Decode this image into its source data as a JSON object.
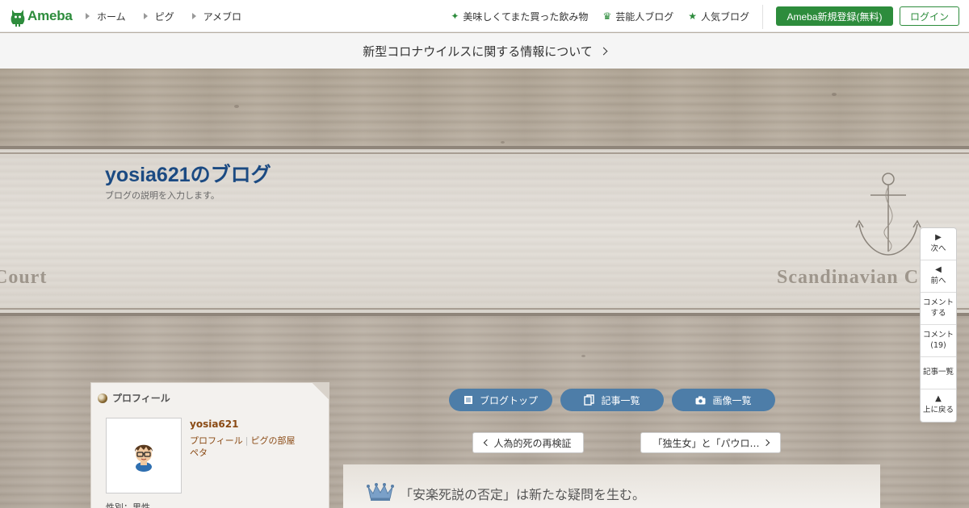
{
  "topbar": {
    "logo_text": "Ameba",
    "nav": [
      "ホーム",
      "ピグ",
      "アメブロ"
    ],
    "right_links": [
      {
        "icon": "sparkle-icon",
        "label": "美味しくてまた買った飲み物"
      },
      {
        "icon": "crown-icon",
        "label": "芸能人ブログ"
      },
      {
        "icon": "star-icon",
        "label": "人気ブログ"
      }
    ],
    "register_label": "Ameba新規登録(無料)",
    "login_label": "ログイン",
    "brand_color": "#2d8c3c"
  },
  "notice": {
    "text": "新型コロナウイルスに関する情報について"
  },
  "blog": {
    "title": "yosia621のブログ",
    "description": "ブログの説明を入力します。",
    "title_color": "#1b4a82",
    "deco_left": "Court",
    "deco_right": "Scandinavian Court"
  },
  "sidenav": {
    "next": "次へ",
    "prev": "前へ",
    "comment_line1": "コメント",
    "comment_line2": "する",
    "comments_line1": "コメント",
    "comments_line2": "(19)",
    "articles": "記事一覧",
    "top_line1": "上に戻る"
  },
  "profile": {
    "heading": "プロフィール",
    "username": "yosia621",
    "link_profile": "プロフィール",
    "link_room": "ピグの部屋",
    "link_peta": "ペタ",
    "gender": "性別：男性"
  },
  "pills": [
    {
      "icon": "document-icon",
      "label": "ブログトップ"
    },
    {
      "icon": "copy-icon",
      "label": "記事一覧"
    },
    {
      "icon": "camera-icon",
      "label": "画像一覧"
    }
  ],
  "pill_color": "#4d7da8",
  "article_nav": {
    "prev": "人為的死の再検証",
    "next": "「独生女」と「パウロ…"
  },
  "article": {
    "title": "「安楽死説の否定」は新たな疑問を生む。"
  }
}
